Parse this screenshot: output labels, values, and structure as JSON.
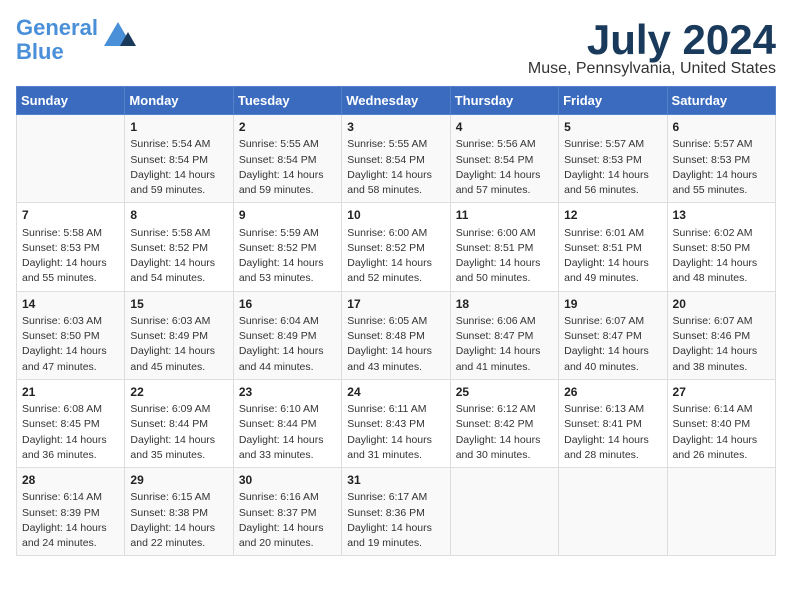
{
  "logo": {
    "line1": "General",
    "line2": "Blue"
  },
  "title": "July 2024",
  "subtitle": "Muse, Pennsylvania, United States",
  "days_of_week": [
    "Sunday",
    "Monday",
    "Tuesday",
    "Wednesday",
    "Thursday",
    "Friday",
    "Saturday"
  ],
  "weeks": [
    [
      {
        "day": "",
        "info": ""
      },
      {
        "day": "1",
        "info": "Sunrise: 5:54 AM\nSunset: 8:54 PM\nDaylight: 14 hours\nand 59 minutes."
      },
      {
        "day": "2",
        "info": "Sunrise: 5:55 AM\nSunset: 8:54 PM\nDaylight: 14 hours\nand 59 minutes."
      },
      {
        "day": "3",
        "info": "Sunrise: 5:55 AM\nSunset: 8:54 PM\nDaylight: 14 hours\nand 58 minutes."
      },
      {
        "day": "4",
        "info": "Sunrise: 5:56 AM\nSunset: 8:54 PM\nDaylight: 14 hours\nand 57 minutes."
      },
      {
        "day": "5",
        "info": "Sunrise: 5:57 AM\nSunset: 8:53 PM\nDaylight: 14 hours\nand 56 minutes."
      },
      {
        "day": "6",
        "info": "Sunrise: 5:57 AM\nSunset: 8:53 PM\nDaylight: 14 hours\nand 55 minutes."
      }
    ],
    [
      {
        "day": "7",
        "info": "Sunrise: 5:58 AM\nSunset: 8:53 PM\nDaylight: 14 hours\nand 55 minutes."
      },
      {
        "day": "8",
        "info": "Sunrise: 5:58 AM\nSunset: 8:52 PM\nDaylight: 14 hours\nand 54 minutes."
      },
      {
        "day": "9",
        "info": "Sunrise: 5:59 AM\nSunset: 8:52 PM\nDaylight: 14 hours\nand 53 minutes."
      },
      {
        "day": "10",
        "info": "Sunrise: 6:00 AM\nSunset: 8:52 PM\nDaylight: 14 hours\nand 52 minutes."
      },
      {
        "day": "11",
        "info": "Sunrise: 6:00 AM\nSunset: 8:51 PM\nDaylight: 14 hours\nand 50 minutes."
      },
      {
        "day": "12",
        "info": "Sunrise: 6:01 AM\nSunset: 8:51 PM\nDaylight: 14 hours\nand 49 minutes."
      },
      {
        "day": "13",
        "info": "Sunrise: 6:02 AM\nSunset: 8:50 PM\nDaylight: 14 hours\nand 48 minutes."
      }
    ],
    [
      {
        "day": "14",
        "info": "Sunrise: 6:03 AM\nSunset: 8:50 PM\nDaylight: 14 hours\nand 47 minutes."
      },
      {
        "day": "15",
        "info": "Sunrise: 6:03 AM\nSunset: 8:49 PM\nDaylight: 14 hours\nand 45 minutes."
      },
      {
        "day": "16",
        "info": "Sunrise: 6:04 AM\nSunset: 8:49 PM\nDaylight: 14 hours\nand 44 minutes."
      },
      {
        "day": "17",
        "info": "Sunrise: 6:05 AM\nSunset: 8:48 PM\nDaylight: 14 hours\nand 43 minutes."
      },
      {
        "day": "18",
        "info": "Sunrise: 6:06 AM\nSunset: 8:47 PM\nDaylight: 14 hours\nand 41 minutes."
      },
      {
        "day": "19",
        "info": "Sunrise: 6:07 AM\nSunset: 8:47 PM\nDaylight: 14 hours\nand 40 minutes."
      },
      {
        "day": "20",
        "info": "Sunrise: 6:07 AM\nSunset: 8:46 PM\nDaylight: 14 hours\nand 38 minutes."
      }
    ],
    [
      {
        "day": "21",
        "info": "Sunrise: 6:08 AM\nSunset: 8:45 PM\nDaylight: 14 hours\nand 36 minutes."
      },
      {
        "day": "22",
        "info": "Sunrise: 6:09 AM\nSunset: 8:44 PM\nDaylight: 14 hours\nand 35 minutes."
      },
      {
        "day": "23",
        "info": "Sunrise: 6:10 AM\nSunset: 8:44 PM\nDaylight: 14 hours\nand 33 minutes."
      },
      {
        "day": "24",
        "info": "Sunrise: 6:11 AM\nSunset: 8:43 PM\nDaylight: 14 hours\nand 31 minutes."
      },
      {
        "day": "25",
        "info": "Sunrise: 6:12 AM\nSunset: 8:42 PM\nDaylight: 14 hours\nand 30 minutes."
      },
      {
        "day": "26",
        "info": "Sunrise: 6:13 AM\nSunset: 8:41 PM\nDaylight: 14 hours\nand 28 minutes."
      },
      {
        "day": "27",
        "info": "Sunrise: 6:14 AM\nSunset: 8:40 PM\nDaylight: 14 hours\nand 26 minutes."
      }
    ],
    [
      {
        "day": "28",
        "info": "Sunrise: 6:14 AM\nSunset: 8:39 PM\nDaylight: 14 hours\nand 24 minutes."
      },
      {
        "day": "29",
        "info": "Sunrise: 6:15 AM\nSunset: 8:38 PM\nDaylight: 14 hours\nand 22 minutes."
      },
      {
        "day": "30",
        "info": "Sunrise: 6:16 AM\nSunset: 8:37 PM\nDaylight: 14 hours\nand 20 minutes."
      },
      {
        "day": "31",
        "info": "Sunrise: 6:17 AM\nSunset: 8:36 PM\nDaylight: 14 hours\nand 19 minutes."
      },
      {
        "day": "",
        "info": ""
      },
      {
        "day": "",
        "info": ""
      },
      {
        "day": "",
        "info": ""
      }
    ]
  ]
}
